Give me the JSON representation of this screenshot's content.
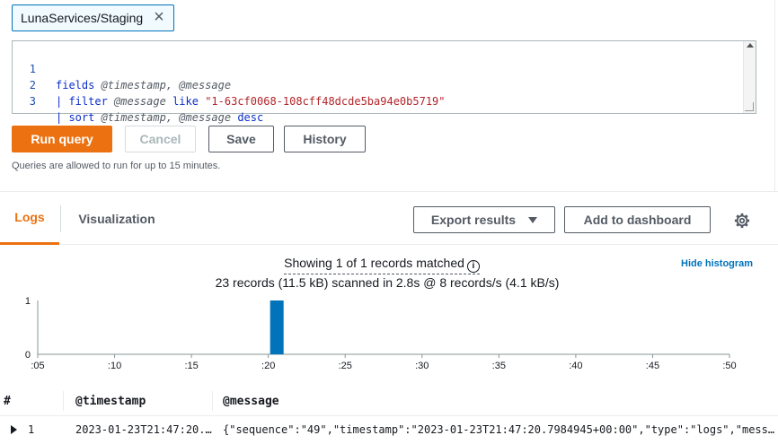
{
  "log_group": {
    "label": "LunaServices/Staging"
  },
  "editor": {
    "lines": [
      {
        "num": "1",
        "kw": "fields",
        "rest": " @timestamp, @message"
      },
      {
        "num": "2",
        "pipe": "| ",
        "kw": "filter",
        "var": " @message ",
        "op": "like",
        "str": " \"1-63cf0068-108cff48dcde5ba94e0b5719\""
      },
      {
        "num": "3",
        "pipe": "| ",
        "kw": "sort",
        "var": " @timestamp, @message ",
        "op": "desc"
      }
    ]
  },
  "actions": {
    "run": "Run query",
    "cancel": "Cancel",
    "save": "Save",
    "history": "History",
    "hint": "Queries are allowed to run for up to 15 minutes."
  },
  "tabs": {
    "logs": "Logs",
    "visualization": "Visualization",
    "export": "Export results",
    "dashboard": "Add to dashboard"
  },
  "results": {
    "showing": "Showing 1 of 1 records matched",
    "scanned": "23 records (11.5 kB) scanned in 2.8s @ 8 records/s (4.1 kB/s)",
    "hide_histogram": "Hide histogram"
  },
  "chart_data": {
    "type": "bar",
    "x_ticks": [
      ":05",
      ":10",
      ":15",
      ":20",
      ":25",
      ":30",
      ":35",
      ":40",
      ":45",
      ":50"
    ],
    "y_ticks": [
      "0",
      "1"
    ],
    "ylim": [
      0,
      1
    ],
    "bars": [
      {
        "x": ":20",
        "value": 1
      }
    ],
    "color": "#0073bb"
  },
  "table": {
    "headers": [
      "#",
      "@timestamp",
      "@message"
    ],
    "rows": [
      {
        "num": "1",
        "timestamp": "2023-01-23T21:47:20.…",
        "message": "{\"sequence\":\"49\",\"timestamp\":\"2023-01-23T21:47:20.7984945+00:00\",\"type\":\"logs\",\"mess…"
      }
    ]
  },
  "icons": {
    "gear": "gear-icon",
    "info": "info-icon",
    "close": "close-icon",
    "caret": "caret-down-icon",
    "expand": "expand-row-icon"
  }
}
